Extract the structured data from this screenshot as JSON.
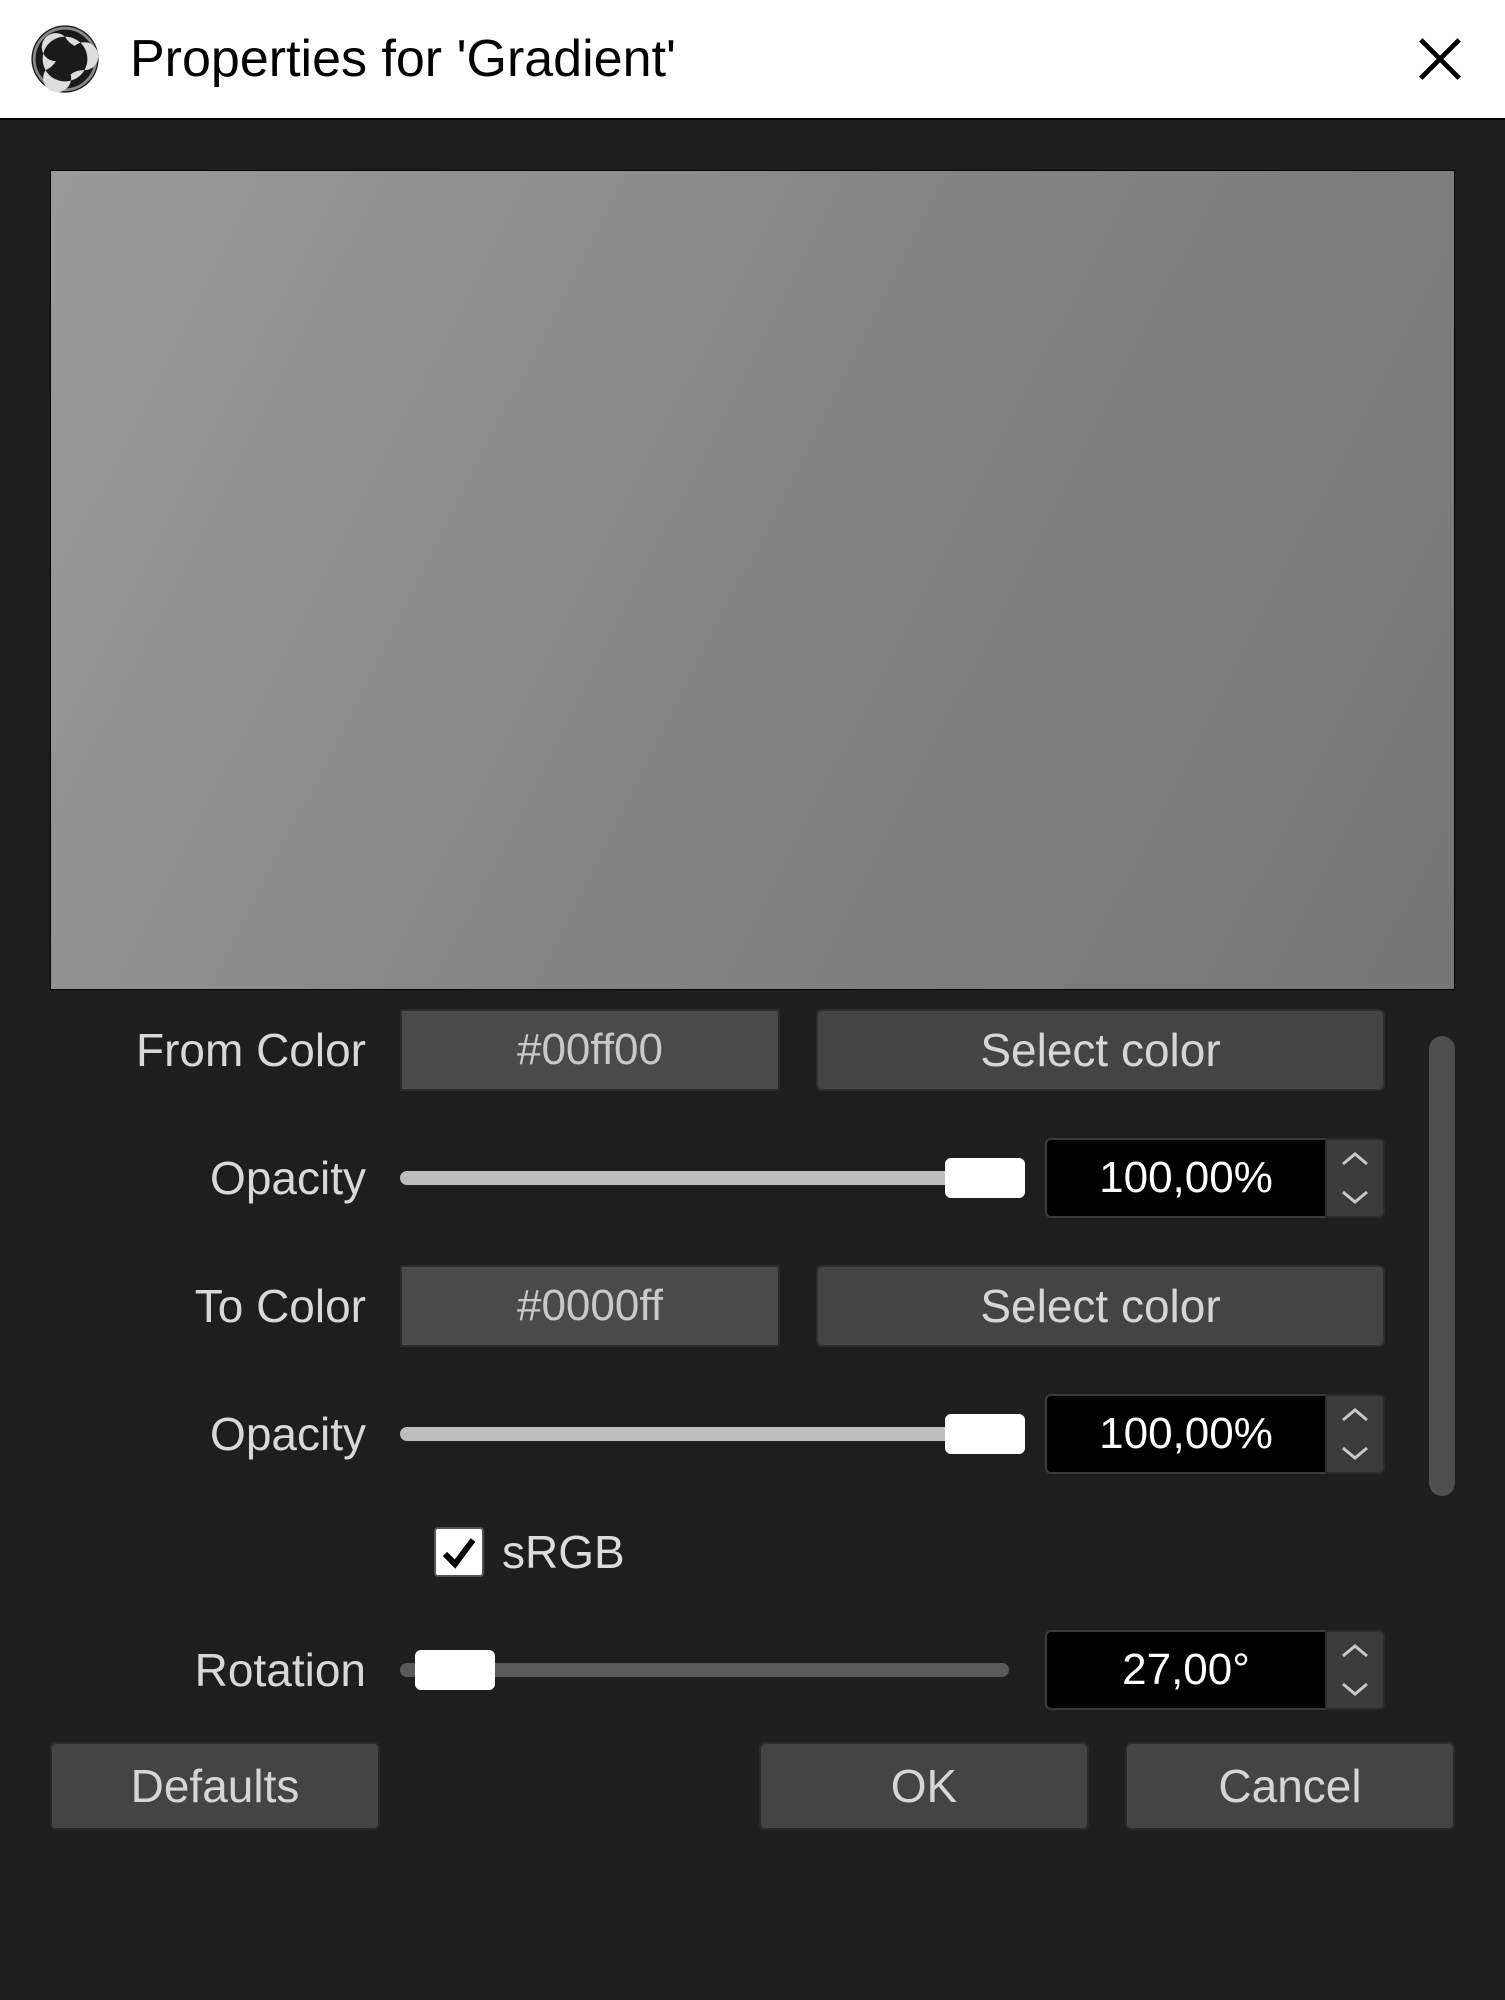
{
  "titlebar": {
    "title": "Properties for 'Gradient'"
  },
  "props": {
    "from_color_label": "From Color",
    "from_color_value": "#00ff00",
    "from_select_label": "Select color",
    "opacity1_label": "Opacity",
    "opacity1_value": "100,00%",
    "opacity1_pos_pct": 96,
    "to_color_label": "To Color",
    "to_color_value": "#0000ff",
    "to_select_label": "Select color",
    "opacity2_label": "Opacity",
    "opacity2_value": "100,00%",
    "opacity2_pos_pct": 96,
    "srgb_label": "sRGB",
    "srgb_checked": true,
    "rotation_label": "Rotation",
    "rotation_value": "27,00°",
    "rotation_pos_pct": 9
  },
  "footer": {
    "defaults_label": "Defaults",
    "ok_label": "OK",
    "cancel_label": "Cancel"
  }
}
